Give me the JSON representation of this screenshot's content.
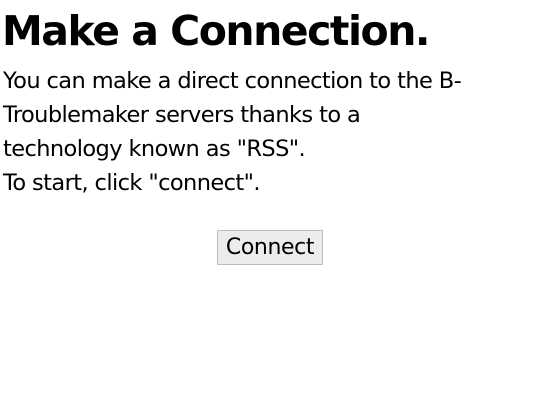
{
  "page": {
    "title": "Make a Connection.",
    "paragraph_lines": [
      "You can make a direct connection to the B-",
      "Troublemaker servers thanks to a",
      "technology known as \"RSS\".",
      "To start, click \"connect\"."
    ]
  },
  "actions": {
    "connect_label": "Connect"
  },
  "colors": {
    "background": "#ffffff",
    "text": "#000000",
    "button_face": "#ececec",
    "button_border": "#bdbdbd"
  }
}
